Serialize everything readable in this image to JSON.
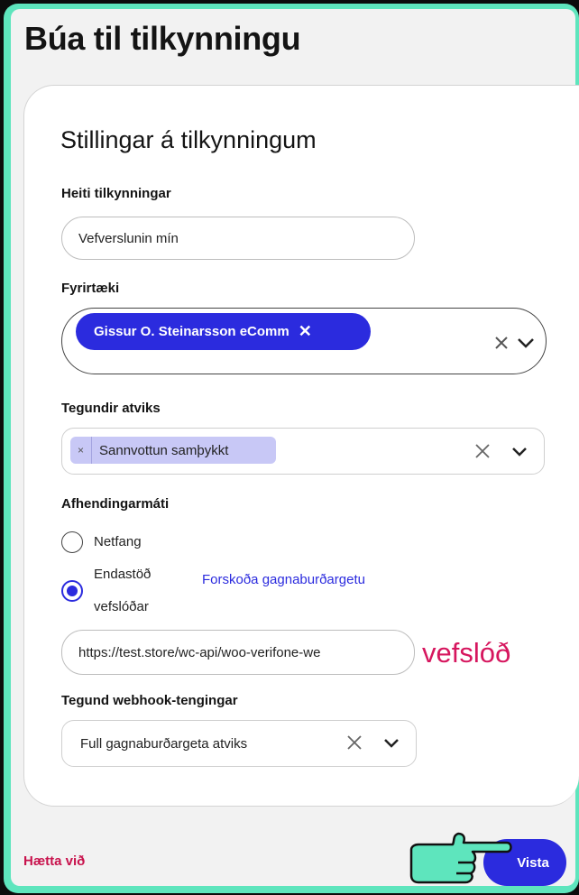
{
  "page": {
    "title": "Búa til tilkynningu"
  },
  "card": {
    "title": "Stillingar á tilkynningum"
  },
  "notification_name": {
    "label": "Heiti tilkynningar",
    "value": "Vefverslunin mín"
  },
  "company": {
    "label": "Fyrirtæki",
    "selected": "Gissur O. Steinarsson eComm",
    "remove": "✕"
  },
  "event_types": {
    "label": "Tegundir atviks",
    "selected": "Sannvottun samþykkt",
    "remove": "×"
  },
  "delivery": {
    "label": "Afhendingarmáti",
    "option_email": "Netfang",
    "option_endpoint_line1": "Endastöð",
    "option_endpoint_line2": "vefslóðar",
    "preview_link": "Forskoða gagnaburðargetu",
    "selected": "endpoint"
  },
  "endpoint_url": {
    "value": "https://test.store/wc-api/woo-verifone-we"
  },
  "annotation": {
    "text": "vefslóð",
    "color": "#d6165e"
  },
  "webhook_type": {
    "label": "Tegund webhook-tengingar",
    "value": "Full gagnaburðargeta atviks"
  },
  "footer": {
    "cancel": "Hætta við",
    "save": "Vista"
  },
  "icons": [
    "clear-icon",
    "chevron-down-icon",
    "pointing-hand-icon"
  ],
  "colors": {
    "accent": "#2b2bde",
    "frame": "#5ee5bd",
    "danger": "#c8134d"
  }
}
